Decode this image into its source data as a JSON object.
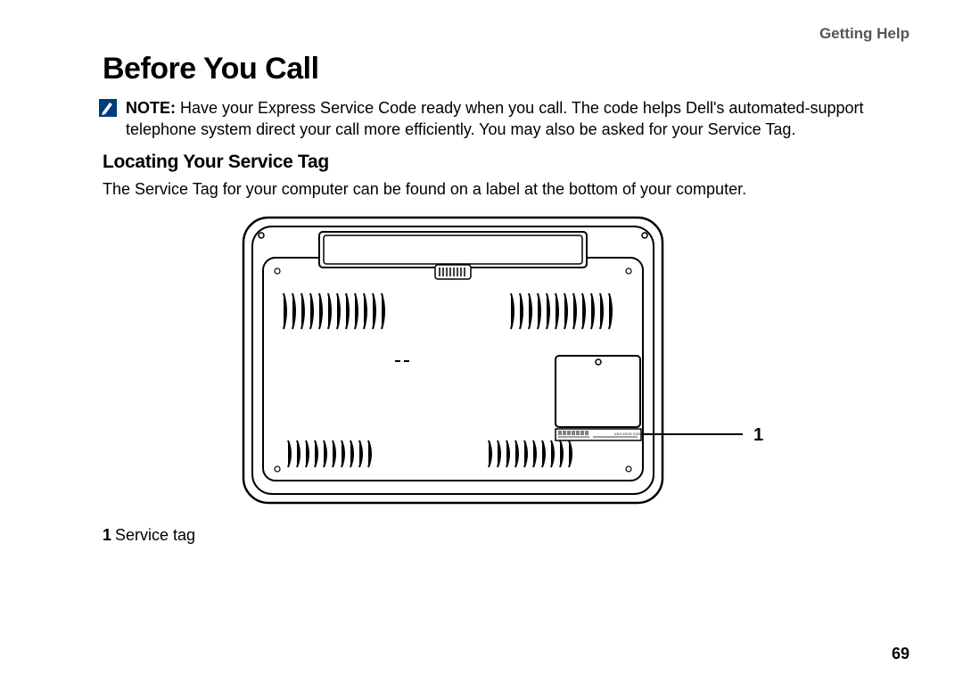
{
  "header": {
    "section": "Getting Help"
  },
  "title": "Before You Call",
  "note": {
    "label": "NOTE:",
    "text": " Have your Express Service Code ready when you call. The code helps Dell's automated-support telephone system direct your call more efficiently. You may also be asked for your Service Tag."
  },
  "subheading": "Locating Your Service Tag",
  "body": "The Service Tag for your computer can be found on a label at the bottom of your computer.",
  "figure": {
    "callout": "1",
    "barcode_text": "XXX XXXX XXX XXXX"
  },
  "legend": {
    "num": "1",
    "label": "Service tag"
  },
  "page_number": "69"
}
